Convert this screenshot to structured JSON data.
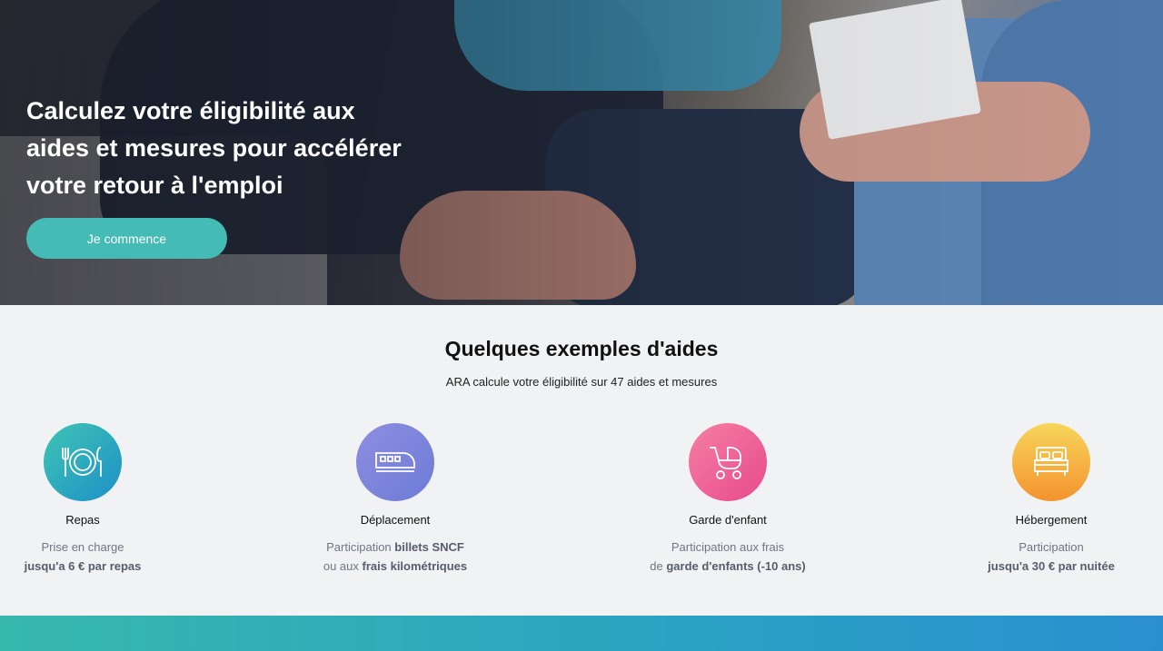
{
  "hero": {
    "title_line1": "Calculez votre éligibilité aux",
    "title_line2": "aides et mesures pour accélérer",
    "title_line3": "votre retour à l'emploi",
    "cta_label": "Je commence"
  },
  "examples": {
    "title": "Quelques exemples d'aides",
    "subtitle": "ARA calcule votre éligibilité sur 47 aides et mesures",
    "items": [
      {
        "icon": "meal-icon",
        "name": "Repas",
        "line1_text": "Prise en charge",
        "line2_bold": "jusqu'a 6 € par repas"
      },
      {
        "icon": "train-icon",
        "name": "Déplacement",
        "line1_text": "Participation ",
        "line1_bold": "billets SNCF",
        "line2_text": "ou aux ",
        "line2_bold": "frais kilométriques"
      },
      {
        "icon": "stroller-icon",
        "name": "Garde d'enfant",
        "line1_text": "Participation aux frais",
        "line2_text": "de ",
        "line2_bold": "garde d'enfants (-10 ans)"
      },
      {
        "icon": "bed-icon",
        "name": "Hébergement",
        "line1_text": "Participation",
        "line2_bold": "jusqu'a 30 € par nuitée"
      }
    ]
  },
  "colors": {
    "cta": "#45bbb6",
    "repas": "#1d8fc8",
    "deplacement": "#7c85da",
    "garde": "#e84a8c",
    "hebergement": "#f4932e"
  }
}
